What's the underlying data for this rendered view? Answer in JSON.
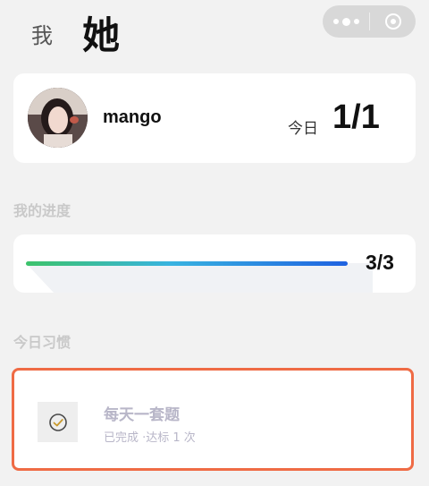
{
  "header": {
    "tab_me": "我",
    "tab_her": "她"
  },
  "profile": {
    "username": "mango",
    "today_label": "今日",
    "today_count": "1/1"
  },
  "progress": {
    "section_title": "我的进度",
    "value_text": "3/3",
    "fraction": 1.0
  },
  "habits": {
    "section_title": "今日习惯",
    "items": [
      {
        "title": "每天一套题",
        "subtitle": "已完成 ·达标 1 次",
        "icon": "check-circle-icon"
      }
    ]
  },
  "colors": {
    "background": "#f2f2f2",
    "habit_border": "#ef6b45",
    "progress_start": "#3cc36b",
    "progress_end": "#1f62e0",
    "muted_text": "#b8b6c8"
  }
}
